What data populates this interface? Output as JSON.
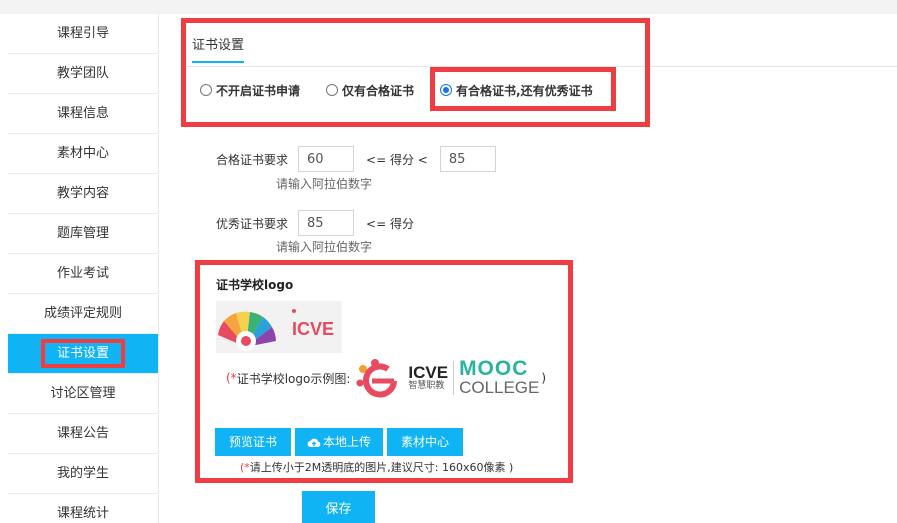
{
  "sidebar": {
    "items": [
      {
        "label": "课程引导"
      },
      {
        "label": "教学团队"
      },
      {
        "label": "课程信息"
      },
      {
        "label": "素材中心"
      },
      {
        "label": "教学内容"
      },
      {
        "label": "题库管理"
      },
      {
        "label": "作业考试"
      },
      {
        "label": "成绩评定规则"
      },
      {
        "label": "证书设置"
      },
      {
        "label": "讨论区管理"
      },
      {
        "label": "课程公告"
      },
      {
        "label": "我的学生"
      },
      {
        "label": "课程统计"
      }
    ],
    "active_index": 8
  },
  "tab": {
    "label": "证书设置"
  },
  "options": {
    "none": "不开启证书申请",
    "pass_only": "仅有合格证书",
    "pass_and_excellent": "有合格证书,还有优秀证书",
    "selected": "pass_and_excellent"
  },
  "pass_req": {
    "label": "合格证书要求",
    "min": "60",
    "op": "<= 得分 <",
    "max": "85",
    "hint": "请输入阿拉伯数字"
  },
  "excellent_req": {
    "label": "优秀证书要求",
    "min": "85",
    "op": "<= 得分",
    "hint": "请输入阿拉伯数字"
  },
  "logo": {
    "title": "证书学校logo",
    "preview_text": "ICVE",
    "example_star": "(*",
    "example_label": "证书学校logo示例图:",
    "example_end": ")",
    "example_icve": "ICVE",
    "example_icve_sub": "智慧职教",
    "example_mooc": "MOOC",
    "example_college": "COLLEGE"
  },
  "buttons": {
    "preview": "预览证书",
    "upload": "本地上传",
    "library": "素材中心",
    "save": "保存"
  },
  "upload_note": {
    "star": "(*",
    "text": "请上传小于2M透明底的图片,建议尺寸: 160x60像素 )"
  },
  "colors": {
    "accent": "#10b3f4",
    "highlight_box": "#ef3d42"
  }
}
